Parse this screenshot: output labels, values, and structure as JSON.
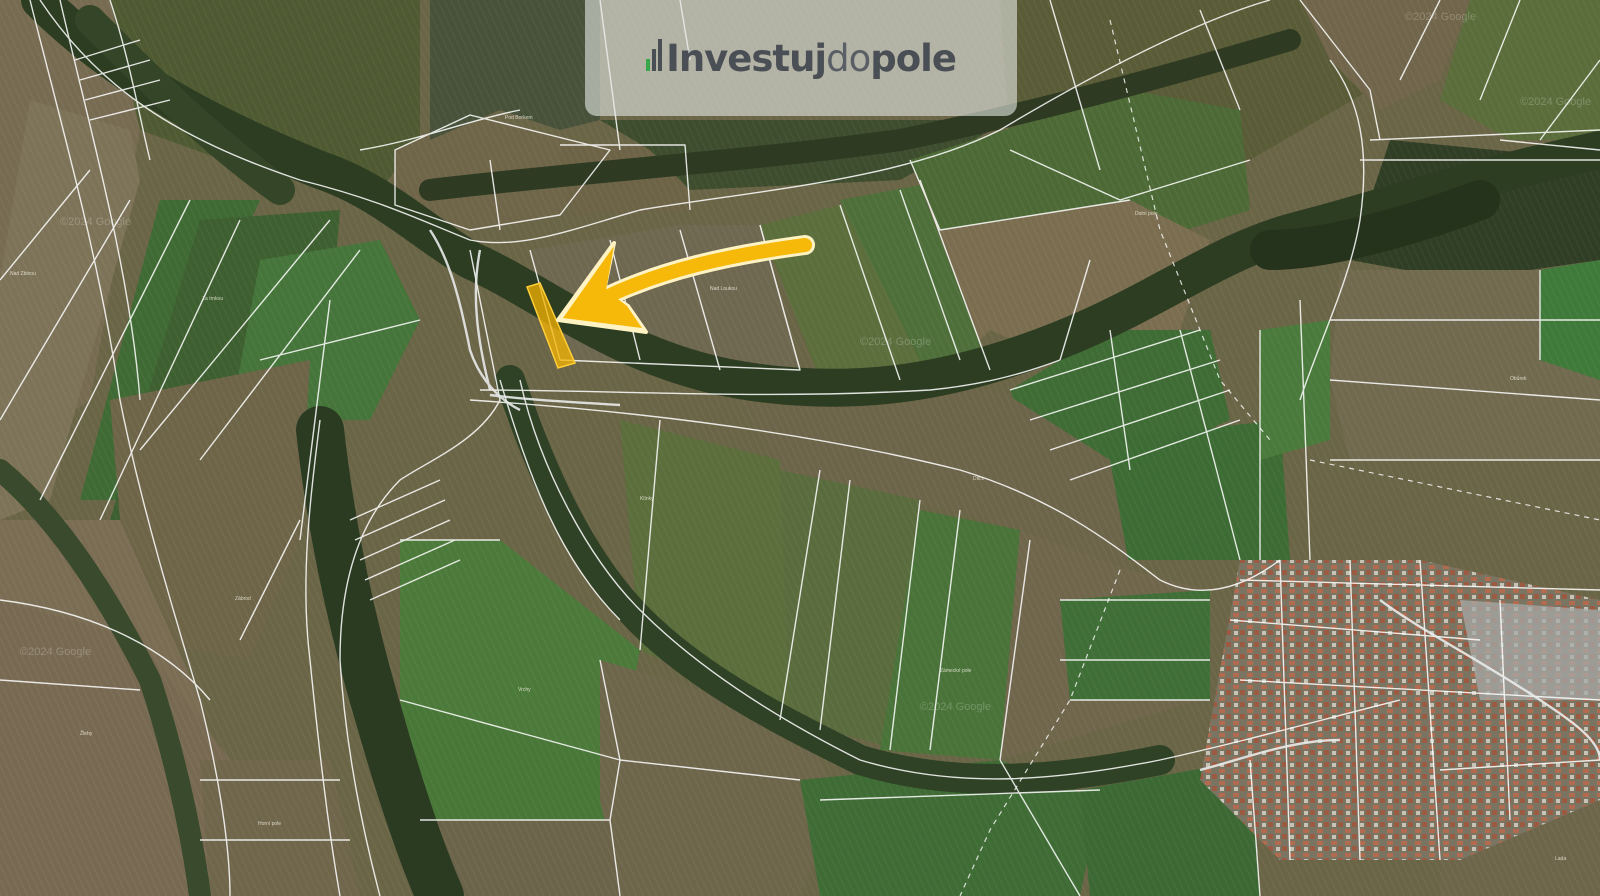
{
  "logo": {
    "part_bold": "Investuj",
    "part_light": "do",
    "part_bold2": "pole",
    "accent_color": "#3aa84a",
    "text_color": "#4a4f55"
  },
  "map": {
    "type": "satellite cadastral map",
    "highlight_color": "#f4b400",
    "arrow_color": "#f6b90a",
    "parcel_line_color": "#ffffff",
    "watermark_text": "©2024 Google",
    "parcel_labels": [
      "Pod Borkem",
      "Nad Zbinou",
      "Za trnkou",
      "Zábrod",
      "Nad Loukou",
      "Dolní pole",
      "Obůrek",
      "Dílce",
      "Klínky",
      "Zámecké pole",
      "Vrchy",
      "Žleby",
      "Horní pole",
      "Lada"
    ]
  }
}
